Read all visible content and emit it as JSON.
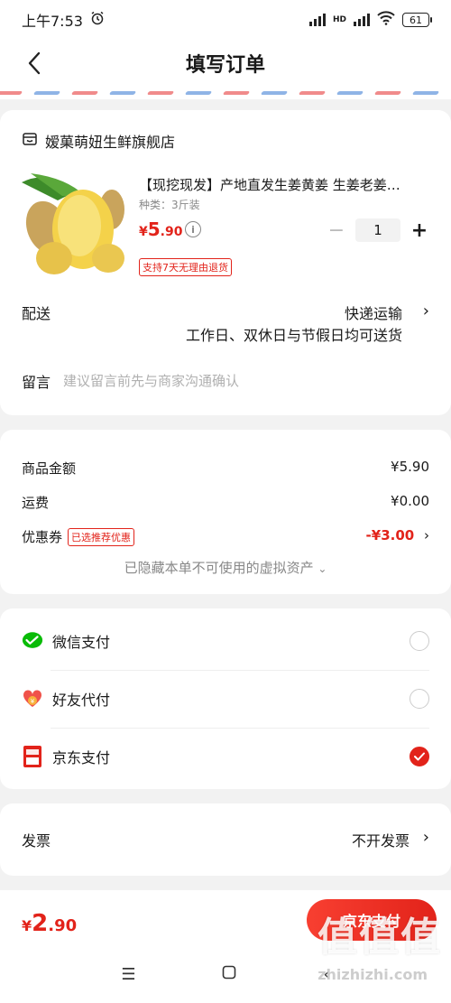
{
  "status_bar": {
    "time": "上午7:53",
    "battery": "61",
    "network": "HD"
  },
  "header": {
    "title": "填写订单"
  },
  "store": {
    "name": "嫒菓萌妞生鲜旗舰店"
  },
  "product": {
    "title": "【现挖现发】产地直发生姜黄姜 生姜老姜…",
    "spec": "种类：3斤装",
    "price_symbol": "¥",
    "price_int": "5",
    "price_dec": ".90",
    "quantity": "1",
    "return_badge": "支持7天无理由退货"
  },
  "delivery": {
    "label": "配送",
    "method": "快递运输",
    "note": "工作日、双休日与节假日均可送货"
  },
  "message": {
    "label": "留言",
    "placeholder": "建议留言前先与商家沟通确认"
  },
  "summary": {
    "goods_label": "商品金额",
    "goods_value": "¥5.90",
    "shipping_label": "运费",
    "shipping_value": "¥0.00",
    "coupon_label": "优惠券",
    "coupon_tag": "已选推荐优惠",
    "coupon_value": "-¥3.00",
    "hidden_note": "已隐藏本单不可使用的虚拟资产"
  },
  "payment": {
    "options": [
      {
        "label": "微信支付",
        "selected": false,
        "icon": "wechat-pay-icon"
      },
      {
        "label": "好友代付",
        "selected": false,
        "icon": "friend-pay-icon"
      },
      {
        "label": "京东支付",
        "selected": true,
        "icon": "jd-pay-icon"
      }
    ]
  },
  "invoice": {
    "label": "发票",
    "value": "不开发票"
  },
  "footer": {
    "total_symbol": "¥",
    "total_int": "2",
    "total_dec": ".90",
    "pay_button": "京东支付"
  },
  "watermark": {
    "main": "值值值",
    "sub": "zhizhizhi.com"
  },
  "colors": {
    "accent": "#e2231a",
    "wechat": "#09bb07",
    "background": "#f2f2f2"
  }
}
